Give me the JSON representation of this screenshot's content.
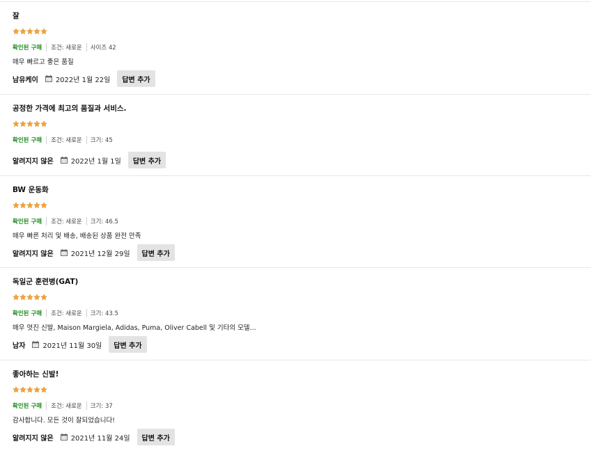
{
  "colors": {
    "star": "#f2a33a",
    "verified": "#1a8a1a",
    "reply_button_bg": "#e3e3e3",
    "divider": "#e8e8e8"
  },
  "icons": {
    "star": "star-icon",
    "date": "calendar-icon"
  },
  "reviews": [
    {
      "title": "잘",
      "rating": 5,
      "verified": "확인된 구매",
      "condition": "조건: 새로운",
      "size": "사이즈 42",
      "body": "매우 빠르고 좋은 품질",
      "author": "남유케이",
      "date": "2022년 1월 22일",
      "reply": "답변 추가"
    },
    {
      "title": "공정한 가격에 최고의 품질과 서비스.",
      "rating": 5,
      "verified": "확인된 구매",
      "condition": "조건: 새로운",
      "size": "크기: 45",
      "body": "",
      "author": "알려지지 않은",
      "date": "2022년 1월 1일",
      "reply": "답변 추가"
    },
    {
      "title": "BW 운동화",
      "rating": 5,
      "verified": "확인된 구매",
      "condition": "조건: 새로운",
      "size": "크기: 46.5",
      "body": "매우 빠른 처리 및 배송, 배송된 상품 완전 만족",
      "author": "알려지지 않은",
      "date": "2021년 12월 29일",
      "reply": "답변 추가"
    },
    {
      "title": "독일군 훈련병(GAT)",
      "rating": 5,
      "verified": "확인된 구매",
      "condition": "조건: 새로운",
      "size": "크기: 43.5",
      "body": "매우 멋진 신발, Maison Margiela, Adidas, Puma, Oliver Cabell 및 기타의 모델...",
      "author": "남자",
      "date": "2021년 11월 30일",
      "reply": "답변 추가"
    },
    {
      "title": "좋아하는 신발!",
      "rating": 5,
      "verified": "확인된 구매",
      "condition": "조건: 새로운",
      "size": "크기: 37",
      "body": "감사합니다. 모든 것이 잘되었습니다!",
      "author": "알려지지 않은",
      "date": "2021년 11월 24일",
      "reply": "답변 추가"
    }
  ]
}
